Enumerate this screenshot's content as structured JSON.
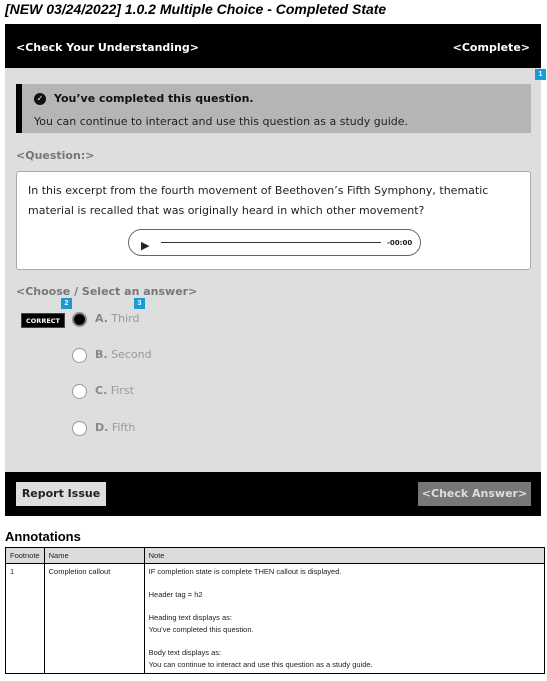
{
  "title": "[NEW 03/24/2022] 1.0.2 Multiple Choice - Completed State",
  "header": {
    "left": "<Check Your Understanding>",
    "right": "<Complete>"
  },
  "badges": [
    "1",
    "2",
    "3"
  ],
  "callout": {
    "heading": "You’ve completed this question.",
    "body": "You can continue to interact and use this question as a study guide.",
    "icon": "check-circle-icon"
  },
  "question": {
    "label": "<Question:>",
    "text": "In this excerpt from the fourth movement of Beethoven’s Fifth Symphony, thematic material is recalled that was originally heard in which other movement?",
    "audio": {
      "play_icon": "▶",
      "time": "-00:00"
    }
  },
  "answers": {
    "label": "<Choose / Select an answer>",
    "correct_tag": "CORRECT",
    "options": [
      {
        "letter": "A.",
        "text": "Third",
        "selected": true
      },
      {
        "letter": "B.",
        "text": "Second",
        "selected": false
      },
      {
        "letter": "C.",
        "text": "First",
        "selected": false
      },
      {
        "letter": "D.",
        "text": "Fifth",
        "selected": false
      }
    ]
  },
  "footer": {
    "report": "Report Issue",
    "check": "<Check Answer>"
  },
  "colors": {
    "badge": "#1a9ad6",
    "header": "#000000",
    "body": "#dedede",
    "callout": "#b5b5b5"
  },
  "annotations": {
    "heading": "Annotations",
    "columns": [
      "Footnote",
      "Name",
      "Note"
    ],
    "rows": [
      {
        "footnote": "1",
        "name": "Completion callout",
        "notes": [
          "IF completion state is complete THEN callout is displayed.",
          "Header tag = h2",
          "Heading text displays as:",
          "You've completed this question.",
          "Body text displays as:",
          "You can continue to interact and use this question as a study guide."
        ]
      }
    ]
  }
}
